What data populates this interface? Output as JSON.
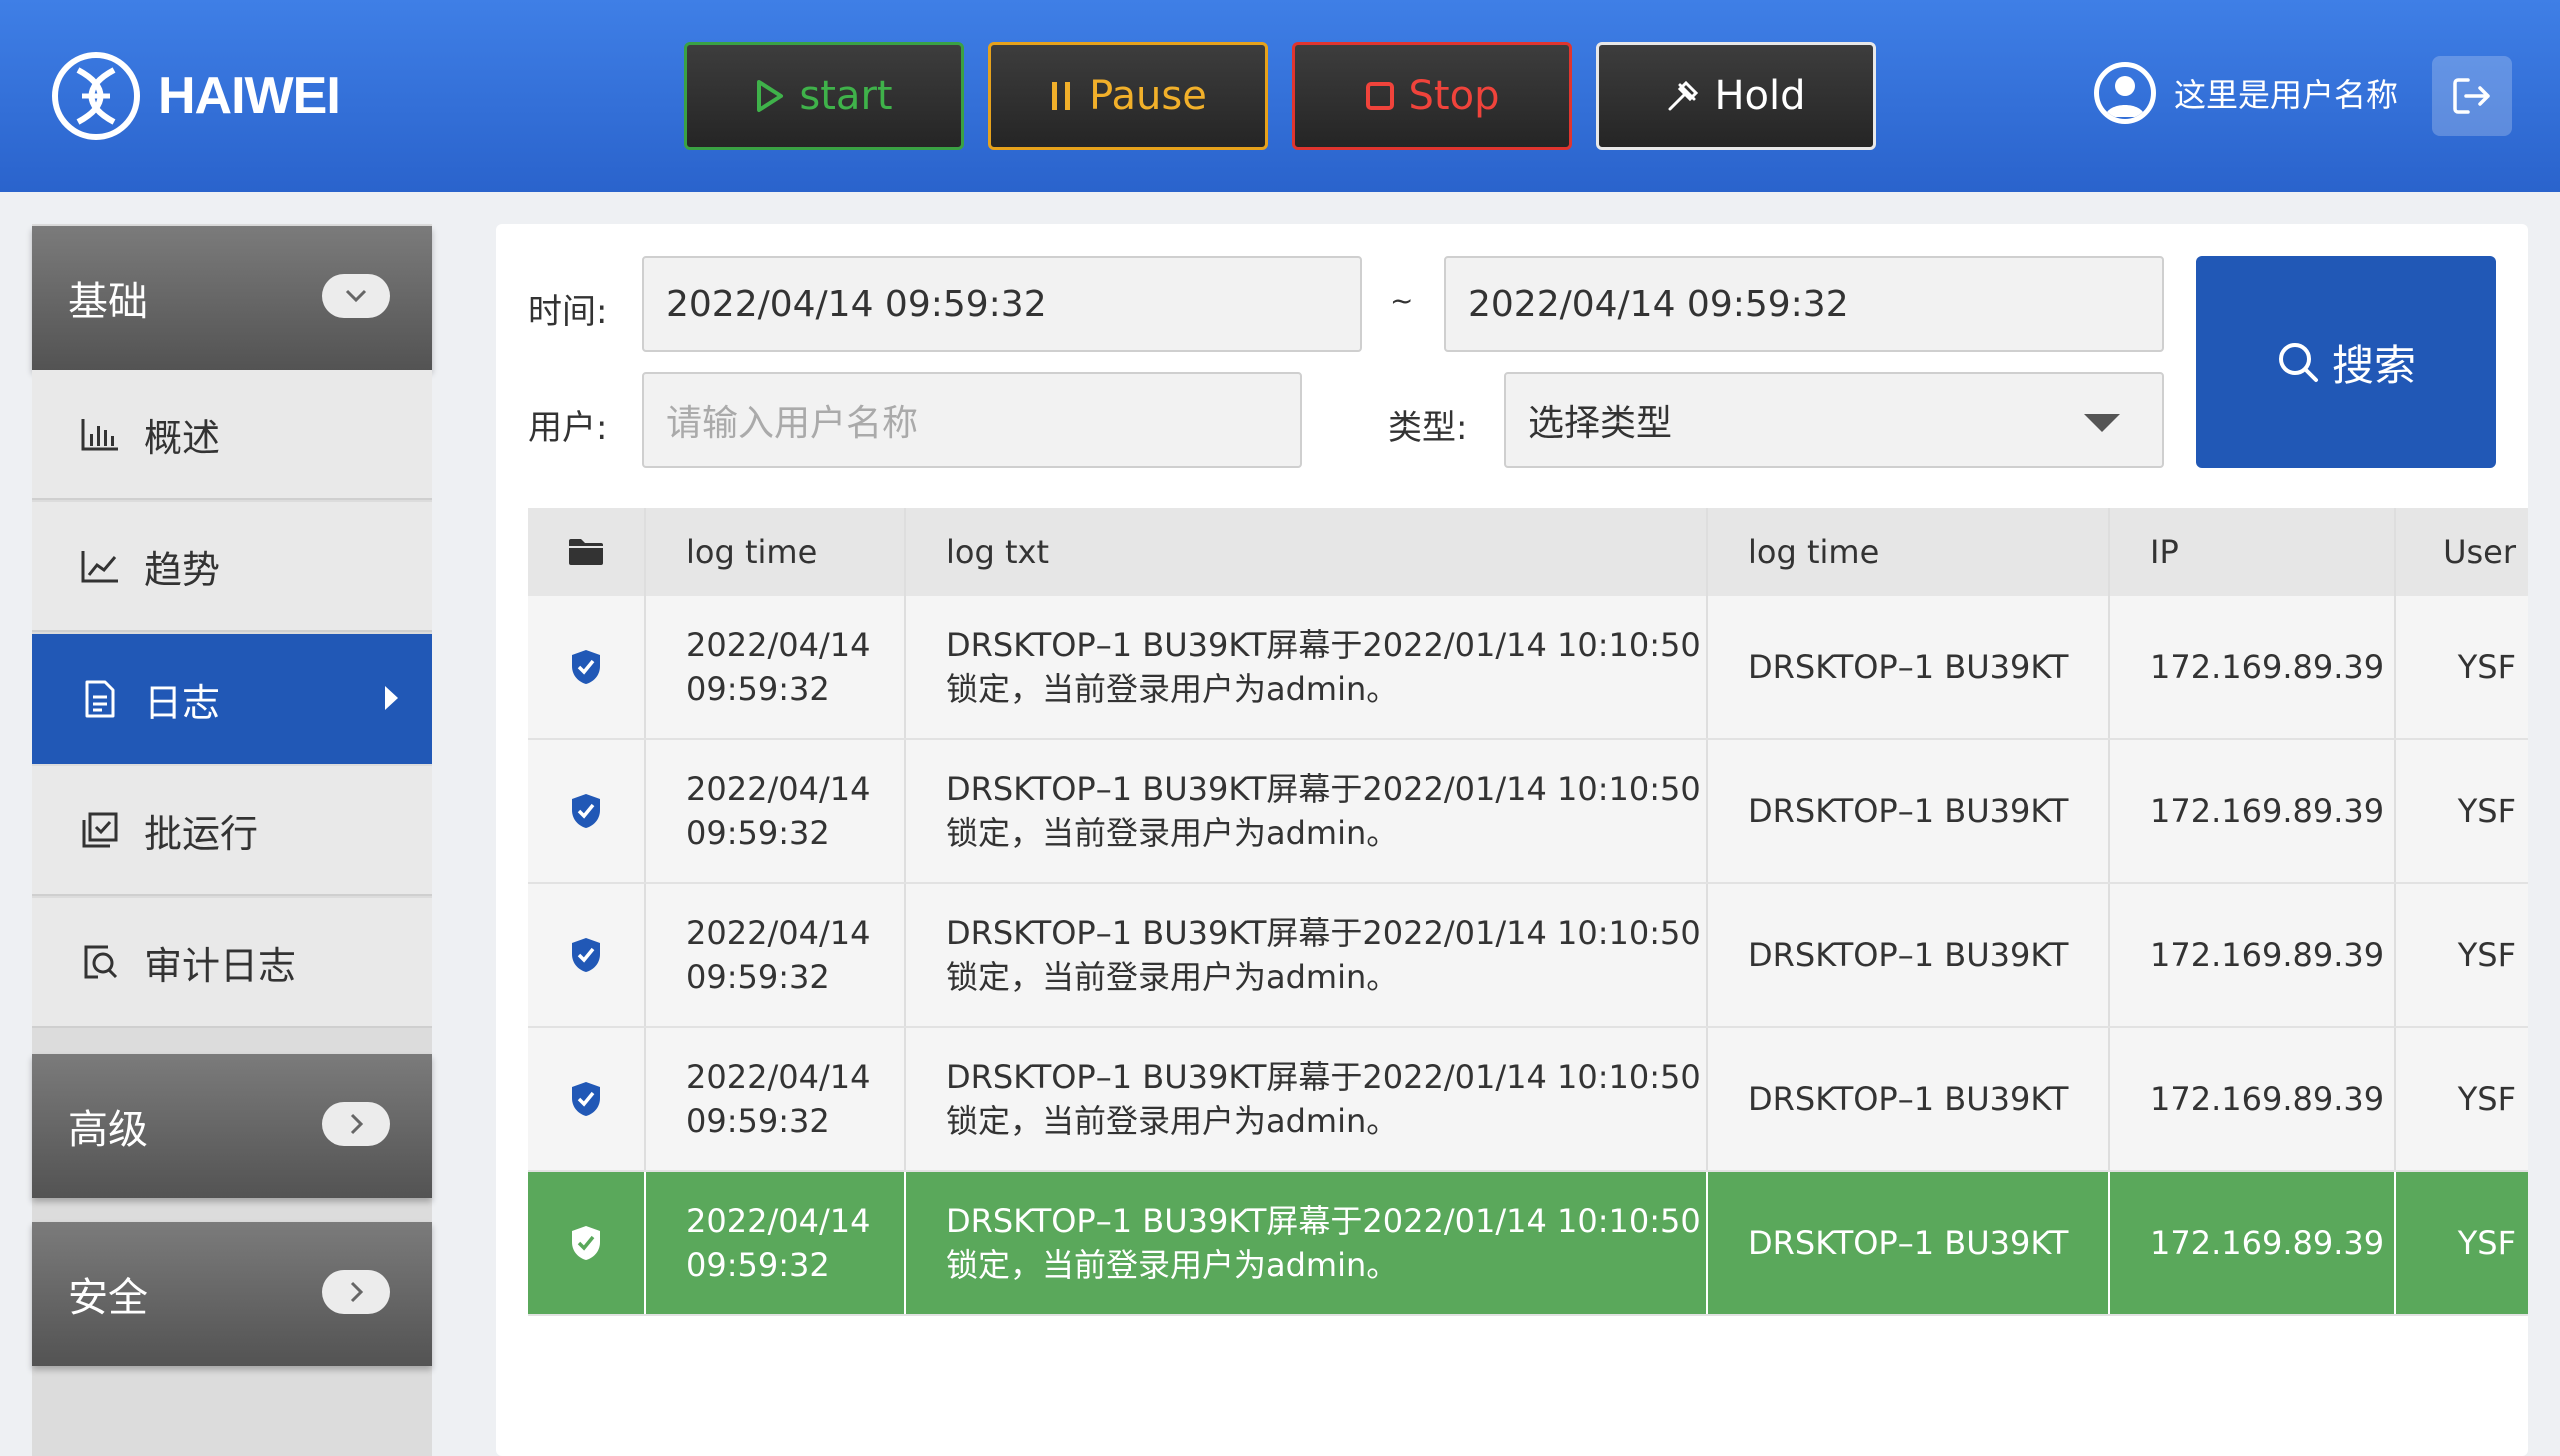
{
  "header": {
    "brand": "HAIWEI",
    "buttons": {
      "start": "start",
      "pause": "Pause",
      "stop": "Stop",
      "hold": "Hold"
    },
    "user_name": "这里是用户名称"
  },
  "sidebar": {
    "groups": [
      {
        "label": "基础",
        "expanded": true,
        "items": [
          {
            "label": "概述",
            "icon": "bar-chart-icon",
            "active": false
          },
          {
            "label": "趋势",
            "icon": "line-chart-icon",
            "active": false
          },
          {
            "label": "日志",
            "icon": "document-icon",
            "active": true
          },
          {
            "label": "批运行",
            "icon": "batch-icon",
            "active": false
          },
          {
            "label": "审计日志",
            "icon": "audit-icon",
            "active": false
          }
        ]
      },
      {
        "label": "高级",
        "expanded": false
      },
      {
        "label": "安全",
        "expanded": false
      }
    ]
  },
  "filters": {
    "time_label": "时间:",
    "time_start": "2022/04/14  09:59:32",
    "range_sep": "~",
    "time_end": "2022/04/14  09:59:32",
    "user_label": "用户:",
    "user_placeholder": "请输入用户名称",
    "type_label": "类型:",
    "type_value": "选择类型",
    "search_label": "搜索"
  },
  "table": {
    "columns": [
      "log time",
      "log txt",
      "log time",
      "IP",
      "User"
    ],
    "rows": [
      {
        "time1": "2022/04/14",
        "time2": "09:59:32",
        "txt1": "DRSKTOP–1 BU39KT屏幕于2022/01/14 10:10:50",
        "txt2": "锁定，当前登录用户为admin。",
        "host": "DRSKTOP–1 BU39KT",
        "ip": "172.169.89.39",
        "user": "YSF",
        "selected": false
      },
      {
        "time1": "2022/04/14",
        "time2": "09:59:32",
        "txt1": "DRSKTOP–1 BU39KT屏幕于2022/01/14 10:10:50",
        "txt2": "锁定，当前登录用户为admin。",
        "host": "DRSKTOP–1 BU39KT",
        "ip": "172.169.89.39",
        "user": "YSF",
        "selected": false
      },
      {
        "time1": "2022/04/14",
        "time2": "09:59:32",
        "txt1": "DRSKTOP–1 BU39KT屏幕于2022/01/14 10:10:50",
        "txt2": "锁定，当前登录用户为admin。",
        "host": "DRSKTOP–1 BU39KT",
        "ip": "172.169.89.39",
        "user": "YSF",
        "selected": false
      },
      {
        "time1": "2022/04/14",
        "time2": "09:59:32",
        "txt1": "DRSKTOP–1 BU39KT屏幕于2022/01/14 10:10:50",
        "txt2": "锁定，当前登录用户为admin。",
        "host": "DRSKTOP–1 BU39KT",
        "ip": "172.169.89.39",
        "user": "YSF",
        "selected": false
      },
      {
        "time1": "2022/04/14",
        "time2": "09:59:32",
        "txt1": "DRSKTOP–1 BU39KT屏幕于2022/01/14 10:10:50",
        "txt2": "锁定，当前登录用户为admin。",
        "host": "DRSKTOP–1 BU39KT",
        "ip": "172.169.89.39",
        "user": "YSF",
        "selected": true
      }
    ]
  },
  "colors": {
    "header": "#2f6fd8",
    "accent": "#2158b6",
    "selected_row": "#5aa85b",
    "start": "#3fb24a",
    "pause": "#f2b02a",
    "stop": "#f0433b"
  }
}
